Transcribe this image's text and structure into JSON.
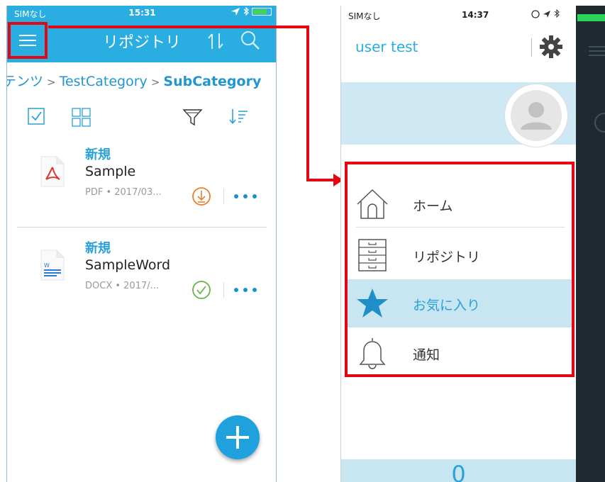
{
  "left_screen": {
    "status": {
      "carrier": "SIMなし",
      "time": "15:31"
    },
    "nav": {
      "title": "リポジトリ"
    },
    "breadcrumb": {
      "part1": "テンツ",
      "part2": "TestCategory",
      "part3": "SubCategory",
      "separator": ">"
    },
    "files": [
      {
        "badge": "新規",
        "name": "Sample",
        "meta": "PDF • 2017/03...",
        "status_icon": "download-pending-icon"
      },
      {
        "badge": "新規",
        "name": "SampleWord",
        "meta": "DOCX • 2017/...",
        "status_icon": "downloaded-check-icon"
      }
    ],
    "colors": {
      "header": "#2aaee2",
      "accent": "#1f8fc8",
      "highlight": "#e30613"
    }
  },
  "right_screen": {
    "status": {
      "carrier": "SIMなし",
      "time": "14:37"
    },
    "user_name": "user test",
    "menu": [
      {
        "label": "ホーム",
        "icon": "home-icon"
      },
      {
        "label": "リポジトリ",
        "icon": "cabinet-icon"
      },
      {
        "label": "お気に入り",
        "icon": "star-icon",
        "active": true
      },
      {
        "label": "通知",
        "icon": "bell-icon"
      }
    ],
    "counter": "0",
    "colors": {
      "banner": "#cfe9f4",
      "active_row": "#c8e6f2",
      "user_name": "#2aaee2"
    }
  }
}
